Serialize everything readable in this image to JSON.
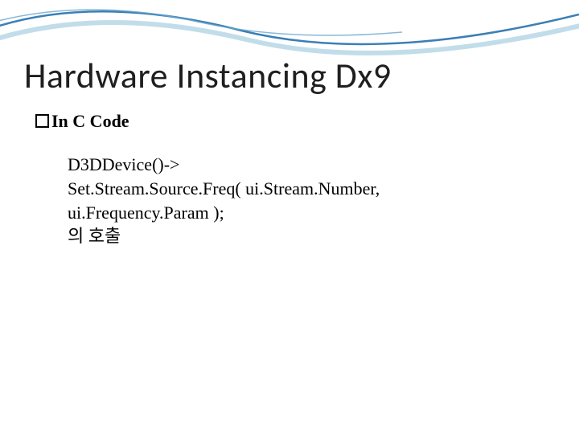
{
  "slide": {
    "title": "Hardware Instancing Dx9",
    "bullet": "In C Code",
    "code": {
      "line1": "D3DDevice()->",
      "line2": "Set.Stream.Source.Freq( ui.Stream.Number, ui.Frequency.Param );",
      "line3": "의 호출"
    }
  }
}
